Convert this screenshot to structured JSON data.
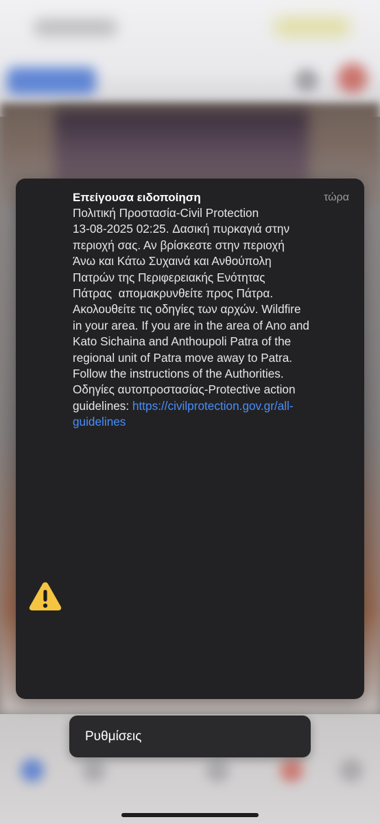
{
  "alert": {
    "title": "Επείγουσα ειδοποίηση",
    "time": "τώρα",
    "lines": [
      "Πολιτική Προστασία-Civil Protection",
      "13-08-2025 02:25. Δασική πυρκαγιά στην",
      "περιοχή σας. Αν βρίσκεστε στην περιοχή",
      "Άνω και Κάτω Συχαινά και Ανθούπολη",
      "Πατρών της Περιφερειακής Ενότητας",
      "Πάτρας  απομακρυνθείτε προς Πάτρα.",
      "Ακολουθείτε τις οδηγίες των αρχών. Wildfire",
      "in your area. If you are in the area of Ano and",
      "Kato Sichaina and Anthoupoli Patra of the",
      "regional unit of Patra move away to Patra.",
      "Follow the instructions of the Authorities.",
      "Οδηγίες αυτοπροστασίας-Protective action",
      "guidelines: "
    ],
    "link_line1": "https://civilprotection.gov.gr/all-",
    "link_line2": "guidelines",
    "icon": "warning-triangle-icon",
    "icon_color": "#f5c542"
  },
  "settings": {
    "label": "Ρυθμίσεις"
  }
}
